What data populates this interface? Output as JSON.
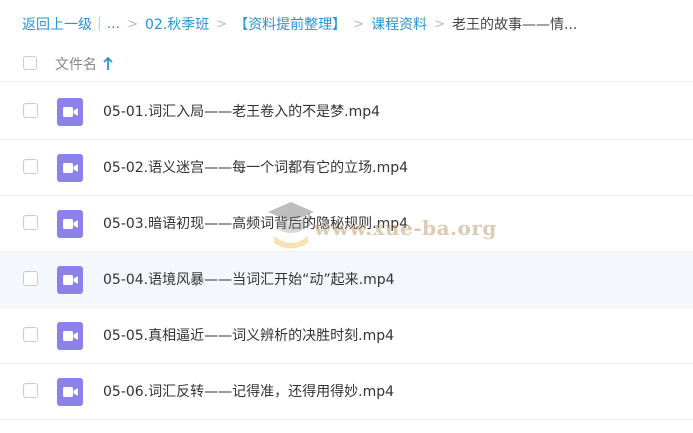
{
  "breadcrumb": {
    "back": "返回上一级",
    "ellipsis": "...",
    "items": [
      "02.秋季班",
      "【资料提前整理】",
      "课程资料"
    ],
    "current": "老王的故事——情..."
  },
  "header": {
    "column_label": "文件名",
    "sort": "ascending"
  },
  "files": [
    {
      "name": "05-01.词汇入局——老王卷入的不是梦.mp4",
      "icon": "video-file-icon"
    },
    {
      "name": "05-02.语义迷宫——每一个词都有它的立场.mp4",
      "icon": "video-file-icon"
    },
    {
      "name": "05-03.暗语初现——高频词背后的隐秘规则.mp4",
      "icon": "video-file-icon"
    },
    {
      "name": "05-04.语境风暴——当词汇开始“动”起来.mp4",
      "icon": "video-file-icon"
    },
    {
      "name": "05-05.真相逼近——词义辨析的决胜时刻.mp4",
      "icon": "video-file-icon"
    },
    {
      "name": "05-06.词汇反转——记得准，还得用得妙.mp4",
      "icon": "video-file-icon"
    }
  ],
  "watermark": {
    "text": "www.xue-ba.org"
  },
  "colors": {
    "link": "#2a94d6",
    "video_icon": "#8a82e8",
    "hover_row": "#f4f8fc"
  }
}
